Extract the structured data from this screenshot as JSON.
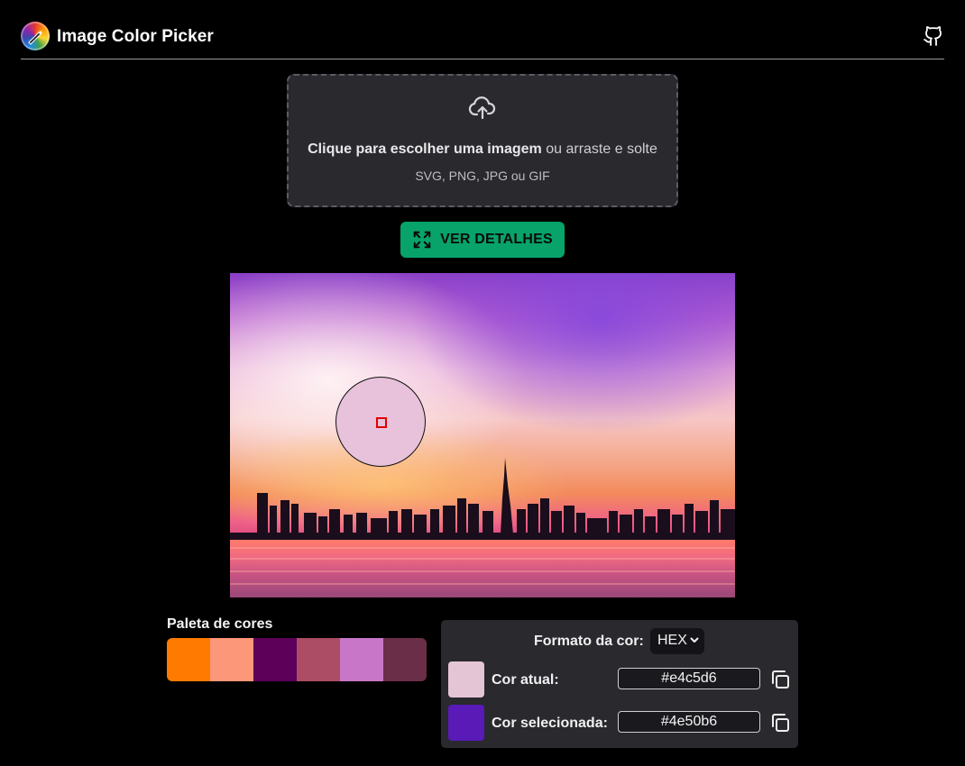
{
  "header": {
    "title": "Image Color Picker",
    "logo_icon": "color-wheel-pencil-icon",
    "github_icon": "github-icon"
  },
  "dropzone": {
    "primary_text": "Clique para escolher uma imagem",
    "secondary_text": "ou arraste e solte",
    "formats_text": "SVG, PNG, JPG ou GIF",
    "icon": "cloud-upload-icon"
  },
  "details_button": {
    "label": "VER DETALHES",
    "icon": "expand-icon",
    "color": "#07a36a"
  },
  "palette": {
    "title": "Paleta de cores",
    "colors": [
      "#ff7a00",
      "#fc9779",
      "#5c0059",
      "#ad4d65",
      "#c877c8",
      "#6a2e48"
    ]
  },
  "color_panel": {
    "format_label": "Formato da cor:",
    "format_value": "HEX",
    "current": {
      "label": "Cor atual:",
      "value": "#e4c5d6",
      "color": "#e4c5d6"
    },
    "selected": {
      "label": "Cor selecionada:",
      "value": "#4e50b6",
      "color": "#5a1ab8"
    }
  },
  "magnifier_color": "#e8c2da"
}
